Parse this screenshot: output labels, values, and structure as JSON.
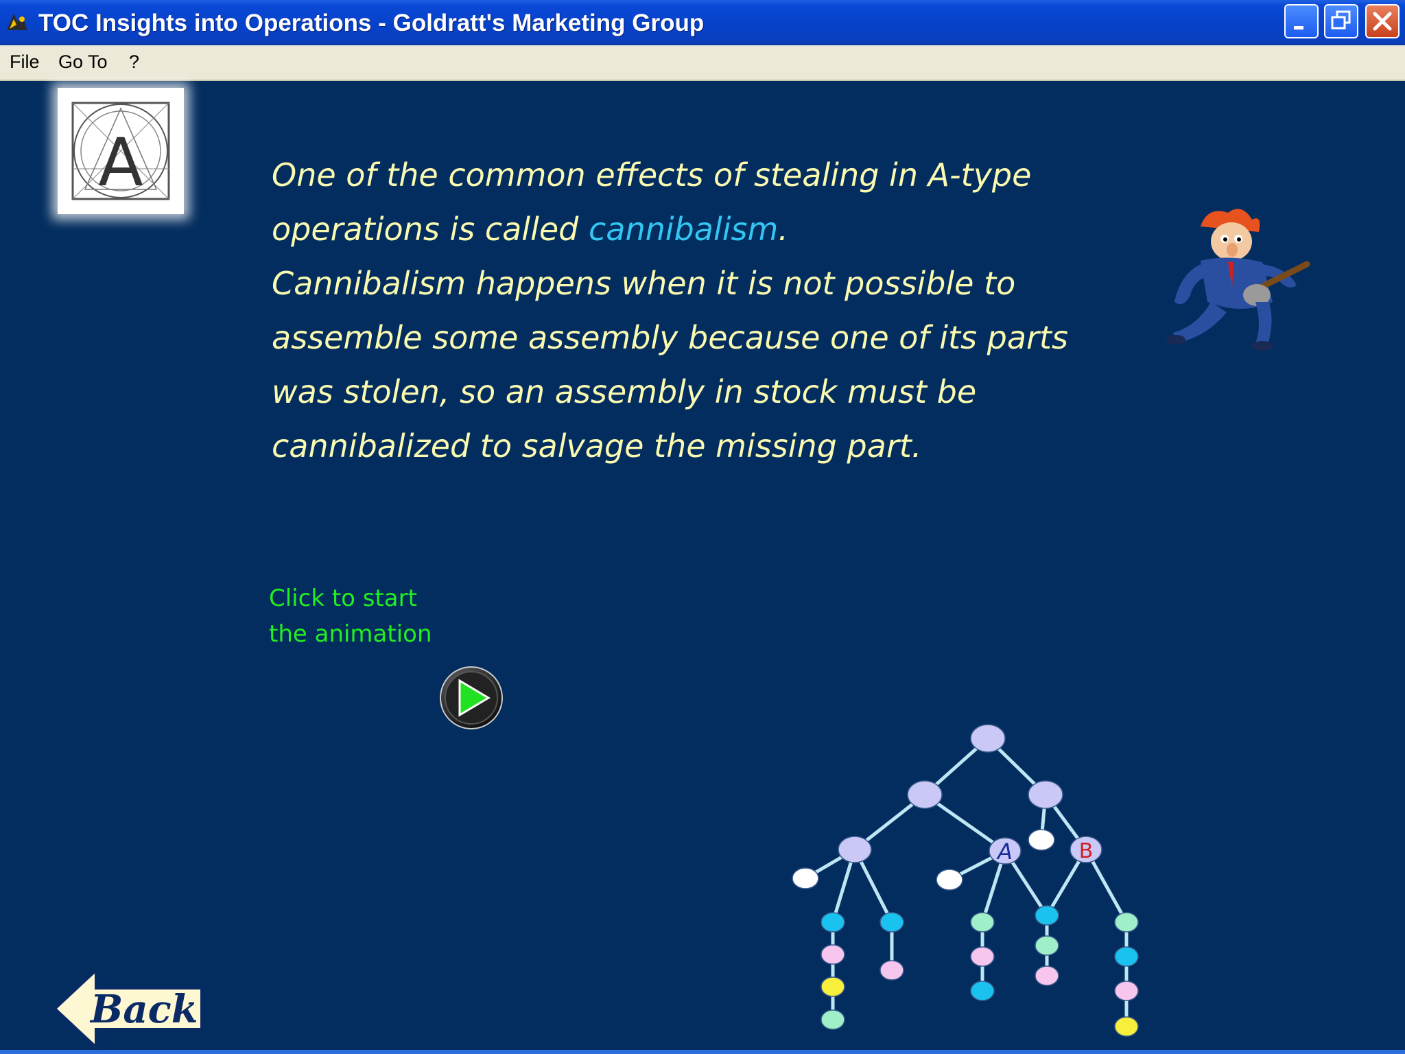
{
  "window": {
    "title": "TOC Insights into Operations - Goldratt's Marketing Group"
  },
  "menu": {
    "items": [
      "File",
      "Go To",
      "?"
    ]
  },
  "logo": {
    "letter": "A"
  },
  "body": {
    "line1": "One of the common effects of stealing in A-type",
    "line2_prefix": "operations is called ",
    "line2_highlight": "cannibalism",
    "line2_suffix": ".",
    "line3": "Cannibalism happens when it is not possible to",
    "line4": "assemble some assembly because one of its parts",
    "line5": "was stolen, so an assembly in stock must be",
    "line6": "cannibalized to salvage the missing part.",
    "highlight_color": "#33c6f2",
    "text_color": "#fafab0"
  },
  "animation": {
    "label_line1": "Click to start",
    "label_line2": "the animation",
    "label_color": "#22ee22",
    "play_icon": "play-icon"
  },
  "tree": {
    "node_labels": {
      "a": "A",
      "b": "B"
    }
  },
  "navigation": {
    "back_label": "Back"
  },
  "colors": {
    "background": "#032d5e",
    "titlebar": "#0a48d6",
    "menubar": "#ece9d8"
  }
}
